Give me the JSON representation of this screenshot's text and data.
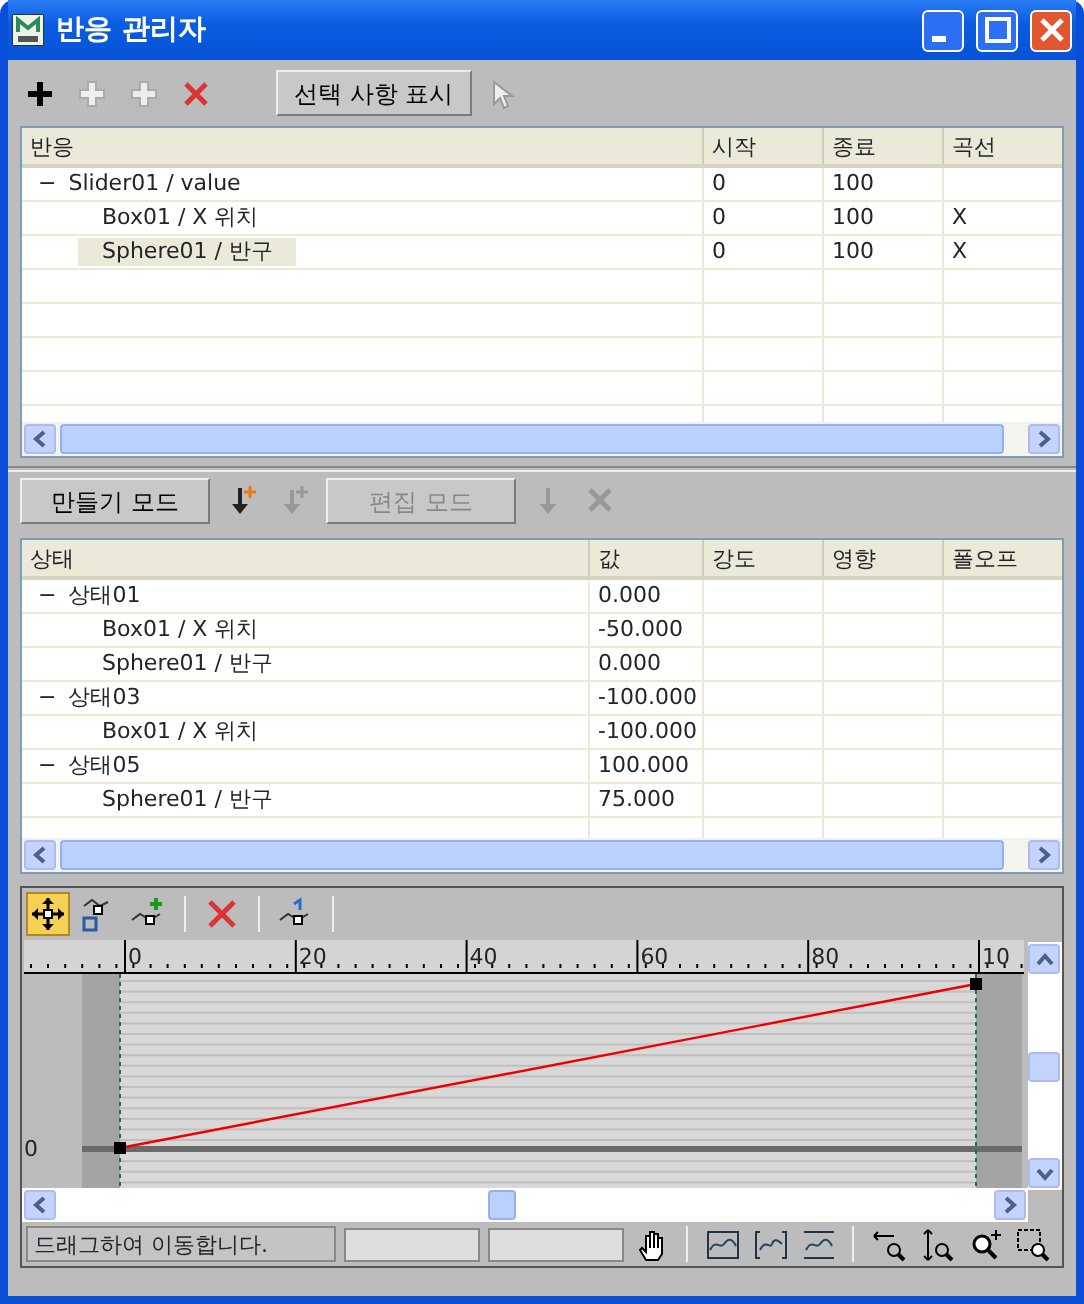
{
  "window": {
    "title": "반응 관리자"
  },
  "reaction_toolbar": {
    "tools": [
      {
        "kind": "add",
        "disabled": false
      },
      {
        "kind": "add-plus",
        "disabled": true
      },
      {
        "kind": "add-plus",
        "disabled": true
      },
      {
        "kind": "delete",
        "disabled": false
      }
    ],
    "show_button": "선택 사항 표시",
    "pick": {
      "kind": "pick",
      "disabled": true
    }
  },
  "reactions_table": {
    "columns": [
      "반응",
      "시작",
      "종료",
      "곡선"
    ],
    "rows": [
      {
        "name": "Slider01 / value",
        "toggle": "−",
        "start": "0",
        "end": "100",
        "selected": false,
        "children": [
          {
            "name": "Box01 / X 위치",
            "start": "0",
            "end": "100",
            "curve": "X",
            "selected": false
          },
          {
            "name": "Sphere01 / 반구",
            "start": "0",
            "end": "100",
            "curve": "X",
            "selected": true
          }
        ]
      }
    ]
  },
  "state_toolbar": {
    "create_mode": {
      "label": "만들기 모드",
      "disabled": false
    },
    "tools_a": [
      {
        "kind": "new-state",
        "disabled": false
      },
      {
        "kind": "append",
        "disabled": true
      }
    ],
    "edit_mode": {
      "label": "편집 모드",
      "disabled": true
    },
    "tools_b": [
      {
        "kind": "down",
        "disabled": true
      },
      {
        "kind": "delete",
        "disabled": true
      }
    ]
  },
  "states_table": {
    "columns": [
      "상태",
      "값",
      "강도",
      "영향",
      "폴오프"
    ],
    "rows": [
      {
        "name": "상태01",
        "toggle": "−",
        "value": "0.000",
        "children": [
          {
            "name": "Box01 / X 위치",
            "value": "-50.000"
          },
          {
            "name": "Sphere01 / 반구",
            "value": "0.000"
          }
        ]
      },
      {
        "name": "상태03",
        "toggle": "−",
        "value": "-100.000",
        "children": [
          {
            "name": "Box01 / X 위치",
            "value": "-100.000"
          }
        ]
      },
      {
        "name": "상태05",
        "toggle": "−",
        "value": "100.000",
        "children": [
          {
            "name": "Sphere01 / 반구",
            "value": "75.000"
          }
        ]
      }
    ]
  },
  "curve_editor": {
    "tools": [
      {
        "kind": "move",
        "selected": true
      },
      {
        "kind": "scale",
        "selected": false
      },
      {
        "kind": "add-key",
        "selected": false
      },
      {
        "kind": "sep"
      },
      {
        "kind": "delete",
        "selected": false
      },
      {
        "kind": "sep"
      },
      {
        "kind": "insert",
        "selected": false
      },
      {
        "kind": "sep"
      }
    ],
    "ruler_labels": [
      "0",
      "20",
      "40",
      "60",
      "80",
      "10"
    ],
    "y_label": "0",
    "status": "드래그하여 이동합니다.",
    "view_tools": [
      {
        "kind": "pan"
      },
      {
        "kind": "sep"
      },
      {
        "kind": "fit"
      },
      {
        "kind": "fit-sel"
      },
      {
        "kind": "fit-all"
      },
      {
        "kind": "sep"
      },
      {
        "kind": "zoom-h"
      },
      {
        "kind": "zoom-v"
      },
      {
        "kind": "zoom"
      },
      {
        "kind": "zoom-region"
      }
    ]
  }
}
